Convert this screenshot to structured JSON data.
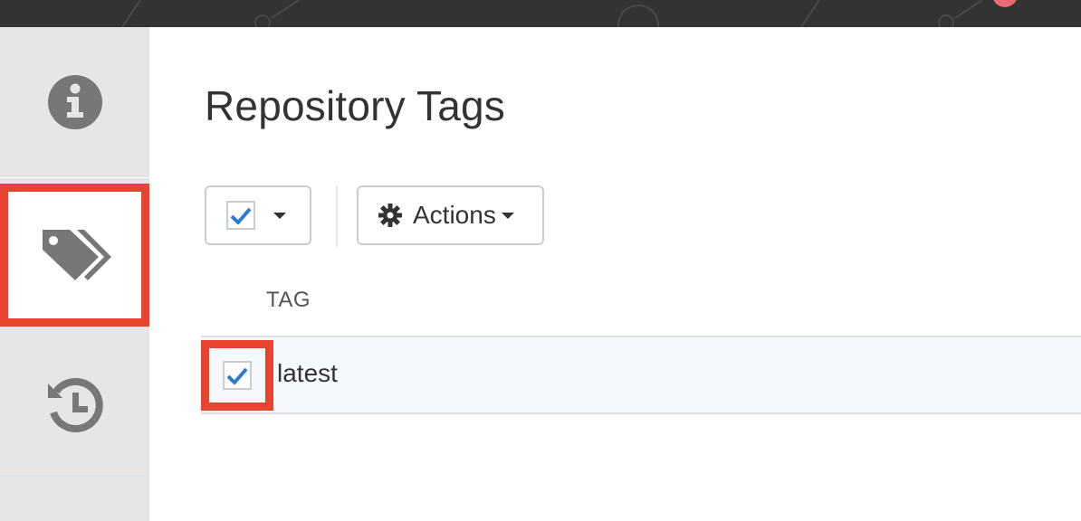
{
  "page": {
    "title": "Repository Tags"
  },
  "sidebar": {
    "items": [
      {
        "name": "info",
        "icon": "info-circle-icon"
      },
      {
        "name": "tags",
        "icon": "tags-icon",
        "active": true
      },
      {
        "name": "history",
        "icon": "history-icon"
      }
    ]
  },
  "toolbar": {
    "select_icon": "checkbox-icon",
    "actions_label": "Actions",
    "actions_icon": "gear-icon"
  },
  "table": {
    "columns": [
      "TAG"
    ],
    "rows": [
      {
        "tag": "latest",
        "checked": true
      }
    ]
  },
  "colors": {
    "topbar": "#333333",
    "sidebar": "#e6e6e6",
    "highlight": "#e8432e",
    "check": "#2b7bd1",
    "icon": "#777777"
  }
}
